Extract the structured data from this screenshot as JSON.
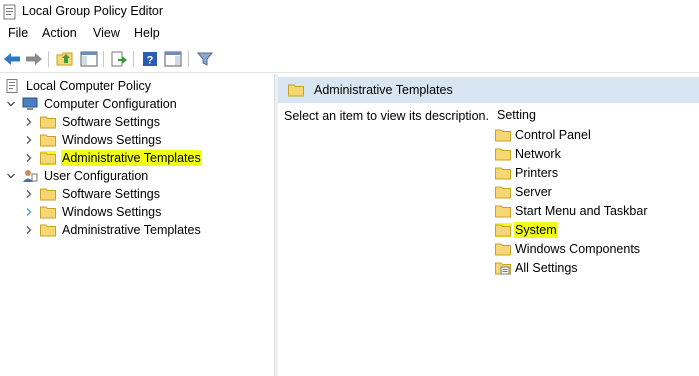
{
  "window": {
    "title": "Local Group Policy Editor"
  },
  "menu": [
    "File",
    "Action",
    "View",
    "Help"
  ],
  "toolbar": {
    "buttons": [
      "back-icon",
      "forward-icon",
      "up-folder-icon",
      "show-hide-tree-icon",
      "export-list-icon",
      "help-icon",
      "properties-pane-icon",
      "filter-icon"
    ]
  },
  "tree": {
    "root": "Local Computer Policy",
    "computer_config": "Computer Configuration",
    "cc_software": "Software Settings",
    "cc_windows": "Windows Settings",
    "cc_admin": "Administrative Templates",
    "user_config": "User Configuration",
    "uc_software": "Software Settings",
    "uc_windows": "Windows Settings",
    "uc_admin": "Administrative Templates"
  },
  "right": {
    "header": "Administrative Templates",
    "description": "Select an item to view its description.",
    "column": "Setting",
    "items": [
      "Control Panel",
      "Network",
      "Printers",
      "Server",
      "Start Menu and Taskbar",
      "System",
      "Windows Components",
      "All Settings"
    ]
  },
  "colors": {
    "highlight": "#f2ff1a",
    "header_bg": "#d8e6f3",
    "folder": "#f7d774"
  }
}
